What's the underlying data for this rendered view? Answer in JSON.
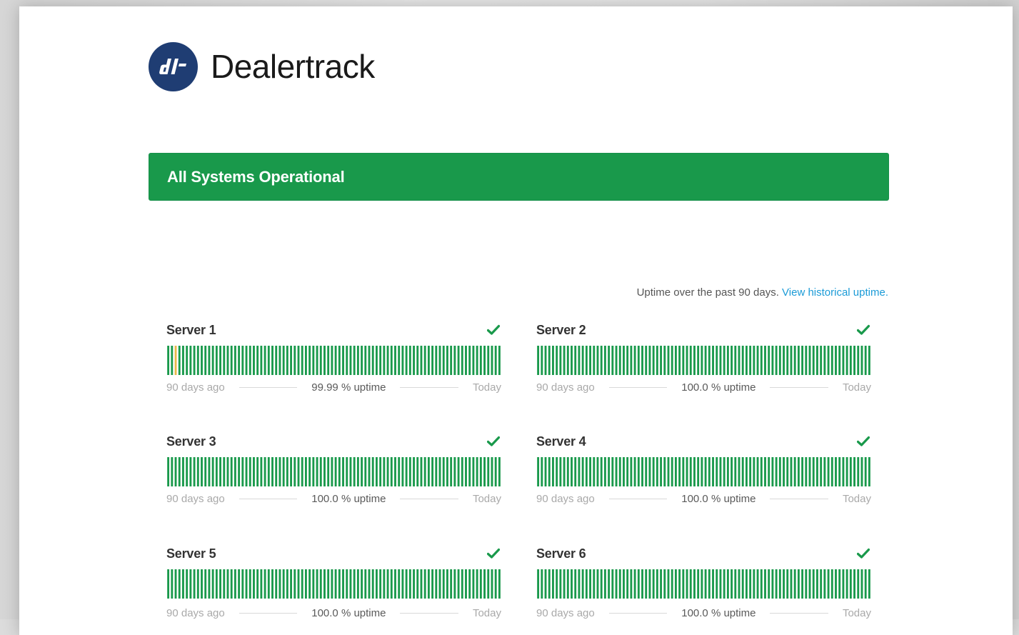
{
  "brand": {
    "name": "Dealertrack",
    "logo_letters": "dt",
    "logo_color": "#1f3d73"
  },
  "status": {
    "label": "All Systems Operational",
    "color": "#19994b"
  },
  "uptime_note": {
    "text": "Uptime over the past 90 days.",
    "link": "View historical uptime."
  },
  "colors": {
    "bar_ok": "#19994b",
    "bar_partial": "#e8b84a",
    "check": "#19994b"
  },
  "servers": [
    {
      "name": "Server 1",
      "uptime": "99.99 % uptime",
      "left_label": "90 days ago",
      "right_label": "Today",
      "status_icon": "check-icon",
      "days": 90,
      "partial_days": [
        2
      ]
    },
    {
      "name": "Server 2",
      "uptime": "100.0 % uptime",
      "left_label": "90 days ago",
      "right_label": "Today",
      "status_icon": "check-icon",
      "days": 90,
      "partial_days": []
    },
    {
      "name": "Server 3",
      "uptime": "100.0 % uptime",
      "left_label": "90 days ago",
      "right_label": "Today",
      "status_icon": "check-icon",
      "days": 90,
      "partial_days": []
    },
    {
      "name": "Server 4",
      "uptime": "100.0 % uptime",
      "left_label": "90 days ago",
      "right_label": "Today",
      "status_icon": "check-icon",
      "days": 90,
      "partial_days": []
    },
    {
      "name": "Server 5",
      "uptime": "100.0 % uptime",
      "left_label": "90 days ago",
      "right_label": "Today",
      "status_icon": "check-icon",
      "days": 90,
      "partial_days": []
    },
    {
      "name": "Server 6",
      "uptime": "100.0 % uptime",
      "left_label": "90 days ago",
      "right_label": "Today",
      "status_icon": "check-icon",
      "days": 90,
      "partial_days": []
    }
  ]
}
